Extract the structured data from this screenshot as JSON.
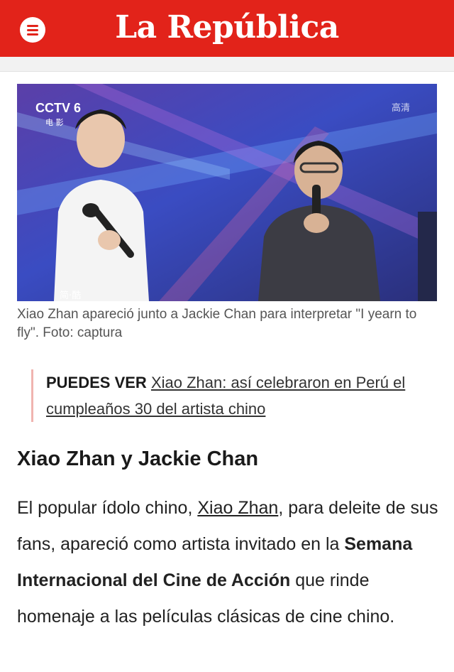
{
  "header": {
    "logo": "La República",
    "menu_icon": "hamburger-menu-icon",
    "brand_color": "#e2231a"
  },
  "photo": {
    "watermark_channel": "CCTV 6",
    "watermark_sub": "电 影",
    "watermark_right": "高清",
    "corner_badge": "简·酷"
  },
  "caption": "Xiao Zhan apareció junto a Jackie Chan para interpretar \"I yearn to fly\". Foto: captura",
  "related": {
    "label": "PUEDES VER",
    "link_text": "Xiao Zhan: así celebraron en Perú el cumpleaños 30 del artista chino"
  },
  "article": {
    "subheading": "Xiao Zhan y Jackie Chan",
    "p1_start": "El popular ídolo chino, ",
    "p1_link": "Xiao Zhan",
    "p1_mid": ", para deleite de sus fans, apareció como artista invitado en la ",
    "p1_bold": "Semana Internacional del Cine de Acción",
    "p1_end": " que rinde homenaje a las películas clásicas de cine chino."
  }
}
